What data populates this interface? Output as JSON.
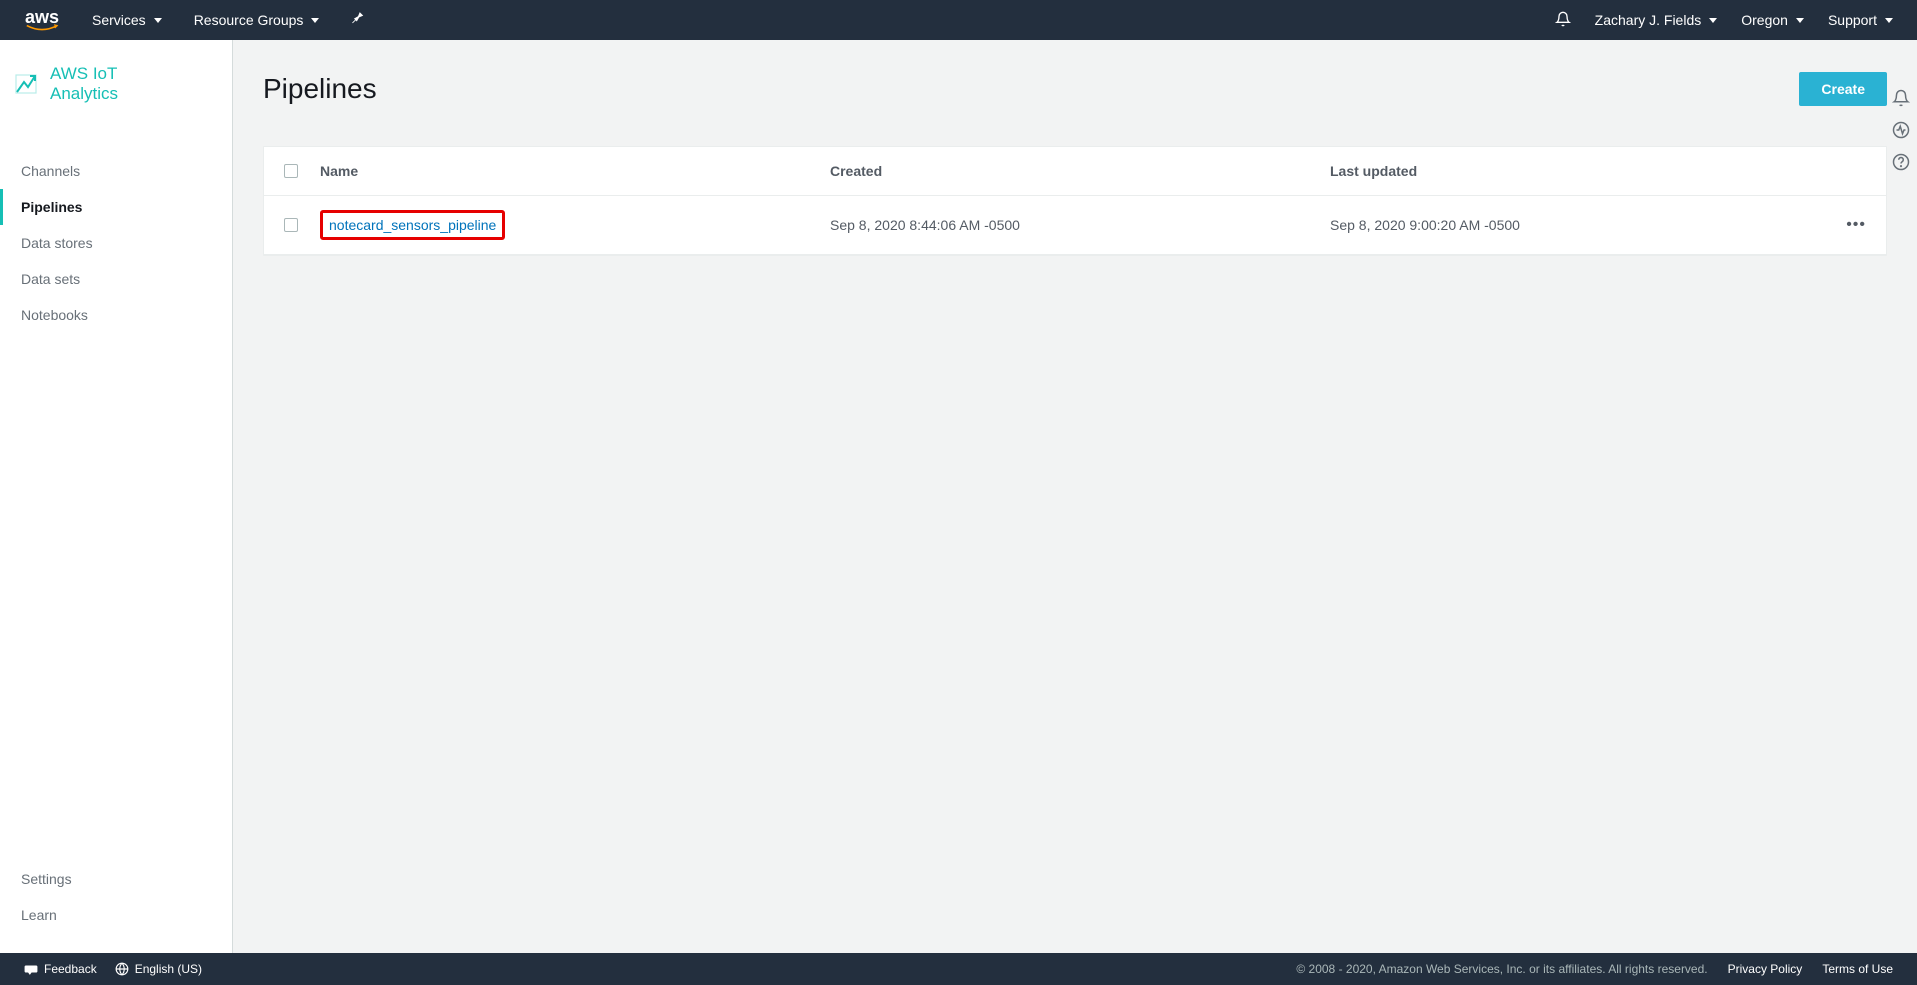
{
  "top_nav": {
    "services": "Services",
    "resource_groups": "Resource Groups",
    "user": "Zachary J. Fields",
    "region": "Oregon",
    "support": "Support"
  },
  "sidebar": {
    "brand": "AWS IoT\nAnalytics",
    "items": [
      {
        "label": "Channels"
      },
      {
        "label": "Pipelines"
      },
      {
        "label": "Data stores"
      },
      {
        "label": "Data sets"
      },
      {
        "label": "Notebooks"
      }
    ],
    "bottom": [
      {
        "label": "Settings"
      },
      {
        "label": "Learn"
      }
    ]
  },
  "page": {
    "title": "Pipelines",
    "create_label": "Create"
  },
  "table": {
    "columns": {
      "name": "Name",
      "created": "Created",
      "updated": "Last updated"
    },
    "rows": [
      {
        "name": "notecard_sensors_pipeline",
        "created": "Sep 8, 2020 8:44:06 AM -0500",
        "updated": "Sep 8, 2020 9:00:20 AM -0500"
      }
    ]
  },
  "footer": {
    "feedback": "Feedback",
    "language": "English (US)",
    "copyright": "© 2008 - 2020, Amazon Web Services, Inc. or its affiliates. All rights reserved.",
    "privacy": "Privacy Policy",
    "terms": "Terms of Use"
  }
}
